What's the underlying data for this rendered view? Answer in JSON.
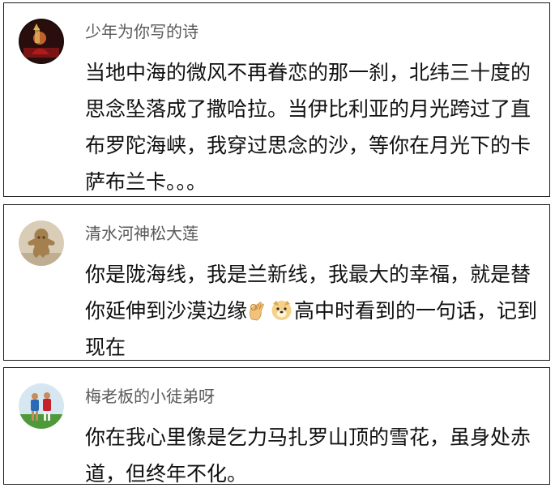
{
  "comments": [
    {
      "avatar": "avatar-red-portrait",
      "username": "少年为你写的诗",
      "text": "当地中海的微风不再眷恋的那一刹，北纬三十度的思念坠落成了撒哈拉。当伊比利亚的月光跨过了直布罗陀海峡，我穿过思念的沙，等你在月光下的卡萨布兰卡。。。"
    },
    {
      "avatar": "avatar-wooden-figure",
      "username": "清水河神松大莲",
      "text_before_emoji": "你是陇海线，我是兰新线，我最大的幸福，就是替你延伸到沙漠边缘",
      "emojis": [
        "ok-hand-emoji",
        "dog-face-emoji"
      ],
      "text_after_emoji": "高中时看到的一句话，记到现在"
    },
    {
      "avatar": "avatar-soccer-players",
      "username": "梅老板的小徒弟呀",
      "text": "你在我心里像是乞力马扎罗山顶的雪花，虽身处赤道，但终年不化。"
    }
  ],
  "colors": {
    "border": "#1a1a1a",
    "username": "#5a5a5a",
    "body_text": "#111111"
  }
}
